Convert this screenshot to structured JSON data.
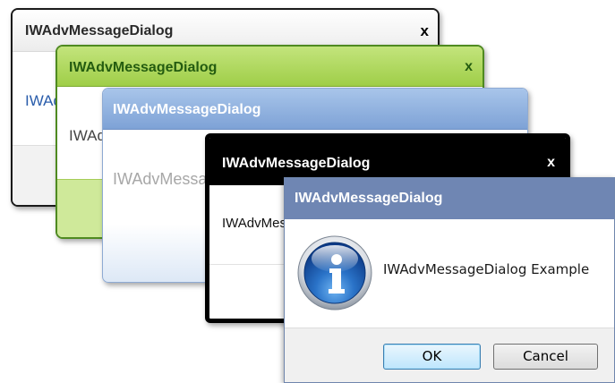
{
  "dialogs": [
    {
      "title": "IWAdvMessageDialog",
      "close": "x",
      "message": "IWAdvMessageDialog"
    },
    {
      "title": "IWAdvMessageDialog",
      "close": "x",
      "message": "IWAdvMessageDialog"
    },
    {
      "title": "IWAdvMessageDialog",
      "message": "IWAdvMessageDialog"
    },
    {
      "title": "IWAdvMessageDialog",
      "close": "x",
      "message": "IWAdvMessageDialog"
    },
    {
      "title": "IWAdvMessageDialog",
      "message": "IWAdvMessageDialog Example",
      "icon": "info-icon",
      "buttons": {
        "ok": "OK",
        "cancel": "Cancel"
      }
    }
  ],
  "colors": {
    "green_title": "#9fce48",
    "blue_title": "#7ea2d6",
    "black_title": "#000000",
    "steel_title": "#6f86b3",
    "ok_border": "#3c7fb1"
  }
}
